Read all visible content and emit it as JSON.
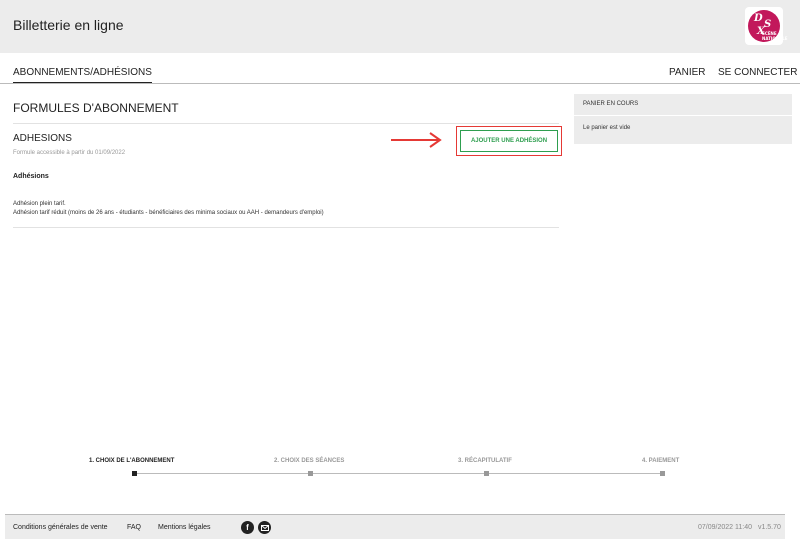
{
  "header": {
    "title": "Billetterie en ligne",
    "logo": {
      "letters": [
        "D",
        "S",
        "X",
        "SCÈNE NATIONALE"
      ],
      "brand_color": "#c2185b"
    }
  },
  "nav": {
    "tabs": [
      {
        "label": "ABONNEMENTS/ADHÉSIONS",
        "active": true
      }
    ],
    "panier": "PANIER",
    "login": "SE CONNECTER"
  },
  "main": {
    "title": "FORMULES D'ABONNEMENT",
    "section": {
      "title": "ADHESIONS",
      "note": "Formule accessible à partir du 01/09/2022",
      "add_button": "AJOUTER UNE ADHÉSION",
      "group_label": "Adhésions",
      "items": [
        "Adhésion plein tarif.",
        "Adhésion tarif réduit (moins de 26 ans - étudiants - bénéficiaires des minima sociaux ou AAH - demandeurs d'emploi)"
      ]
    }
  },
  "cart": {
    "title": "PANIER EN COURS",
    "empty_text": "Le panier est vide"
  },
  "steps": [
    {
      "label": "1. CHOIX DE L'ABONNEMENT",
      "active": true
    },
    {
      "label": "2. CHOIX DES SÉANCES",
      "active": false
    },
    {
      "label": "3. RÉCAPITULATIF",
      "active": false
    },
    {
      "label": "4. PAIEMENT",
      "active": false
    }
  ],
  "footer": {
    "links": [
      "Conditions générales de vente",
      "FAQ",
      "Mentions légales"
    ],
    "social_icons": [
      "facebook-icon",
      "email-icon"
    ],
    "timestamp": "07/09/2022 11:40",
    "version": "v1.5.70"
  },
  "colors": {
    "header_bg": "#ececec",
    "accent_green": "#2e9e4f",
    "highlight_red": "#e53935"
  }
}
